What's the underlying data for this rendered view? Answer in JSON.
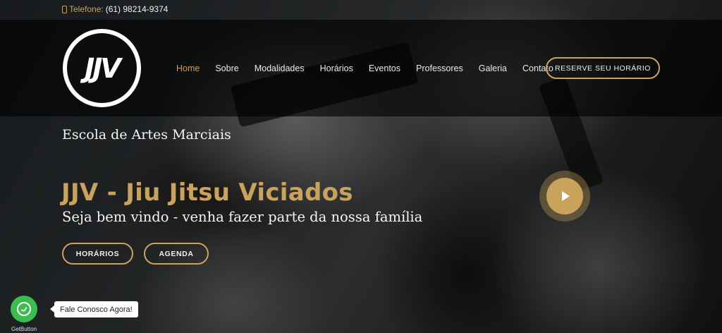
{
  "colors": {
    "accent": "#c9a25c",
    "whatsapp": "#3bbd4d"
  },
  "topbar": {
    "phone_label": "Telefone:",
    "phone_number": "(61) 98214-9374",
    "icon": "phone-icon"
  },
  "header": {
    "logo_text": "JJV",
    "nav": [
      {
        "label": "Home",
        "active": true
      },
      {
        "label": "Sobre"
      },
      {
        "label": "Modalidades"
      },
      {
        "label": "Horários"
      },
      {
        "label": "Eventos"
      },
      {
        "label": "Professores"
      },
      {
        "label": "Galeria"
      },
      {
        "label": "Contato"
      }
    ],
    "reserve_label": "RESERVE SEU HORÁRIO"
  },
  "hero": {
    "subtitle": "Escola de Artes Marciais",
    "title": "JJV - Jiu Jitsu Viciados",
    "tagline": "Seja bem vindo - venha fazer parte da nossa família",
    "buttons": {
      "horarios": "HORÁRIOS",
      "agenda": "AGENDA"
    },
    "play_icon": "play-icon"
  },
  "whatsapp": {
    "tooltip": "Fale Conosco Agora!",
    "brand": "GetButton",
    "icon": "whatsapp-icon"
  }
}
